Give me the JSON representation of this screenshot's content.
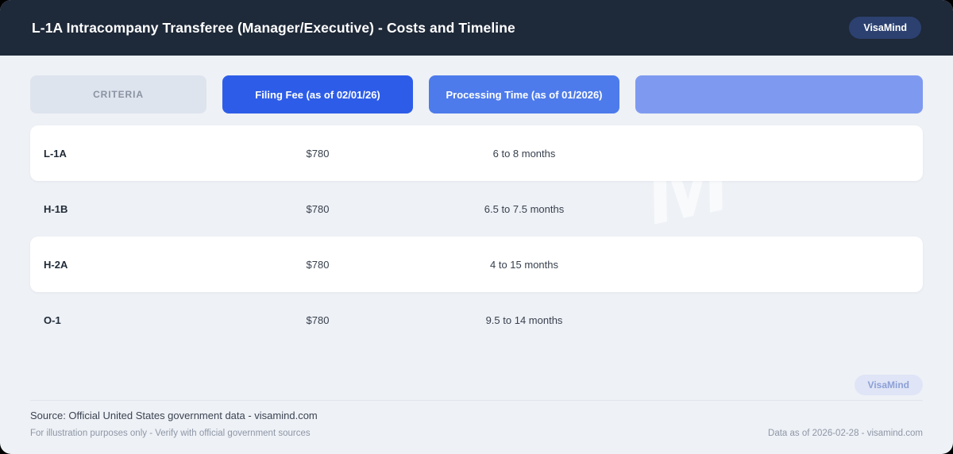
{
  "header": {
    "title": "L-1A Intracompany Transferee (Manager/Executive) - Costs and Timeline",
    "badge_label": "VisaMind"
  },
  "columns": [
    {
      "label": "CRITERIA"
    },
    {
      "label": "Filing Fee (as of 02/01/26)"
    },
    {
      "label": "Processing Time (as of 01/2026)"
    },
    {
      "label": ""
    }
  ],
  "rows": [
    {
      "criteria": "L-1A",
      "filing_fee": "$780",
      "processing_time": "6 to 8 months",
      "extra": ""
    },
    {
      "criteria": "H-1B",
      "filing_fee": "$780",
      "processing_time": "6.5 to 7.5 months",
      "extra": ""
    },
    {
      "criteria": "H-2A",
      "filing_fee": "$780",
      "processing_time": "4 to 15 months",
      "extra": ""
    },
    {
      "criteria": "O-1",
      "filing_fee": "$780",
      "processing_time": "9.5 to 14 months",
      "extra": ""
    }
  ],
  "watermark": "M",
  "footer": {
    "badge_label": "VisaMind",
    "source": "Source: Official United States government data - visamind.com",
    "disclaimer": "For illustration purposes only - Verify with official government sources",
    "data_as_of": "Data as of 2026-02-28 - visamind.com"
  },
  "colors": {
    "header_bg": "#1e2939",
    "header_badge_bg": "#2c4170",
    "page_bg": "#eef1f6",
    "criteria_button_bg": "#dee4ee",
    "fee_button_bg": "#2d5de8",
    "time_button_bg": "#4d7beb",
    "extra_button_bg": "#7e9af0",
    "footer_badge_bg": "#dfe5f6",
    "footer_badge_text": "#8da0d6"
  }
}
